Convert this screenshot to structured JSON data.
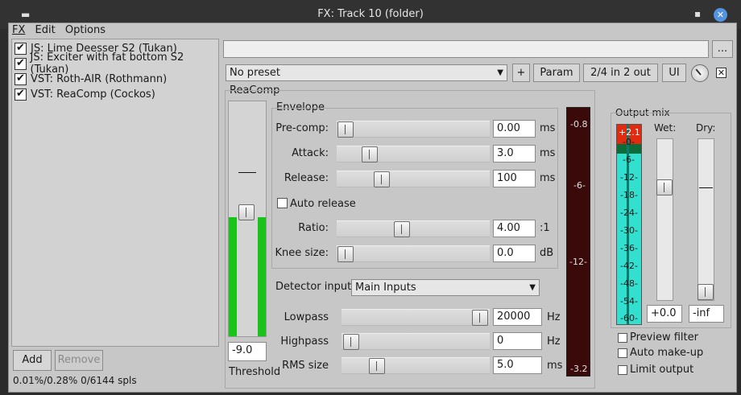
{
  "window": {
    "title": "FX: Track 10 (folder)"
  },
  "menu": {
    "fx": "FX",
    "edit": "Edit",
    "options": "Options"
  },
  "fx_chain": [
    {
      "label": "JS: Lime Deesser S2 (Tukan)",
      "enabled": true
    },
    {
      "label": "JS: Exciter with fat bottom S2 (Tukan)",
      "enabled": true
    },
    {
      "label": "VST: Roth-AIR (Rothmann)",
      "enabled": true
    },
    {
      "label": "VST: ReaComp (Cockos)",
      "enabled": true
    }
  ],
  "buttons": {
    "add": "Add",
    "remove": "Remove",
    "browse": "...",
    "plus": "+",
    "param": "Param",
    "io": "2/4 in 2 out",
    "ui": "UI"
  },
  "status": "0.01%/0.28% 0/6144 spls",
  "preset": {
    "value": "No preset"
  },
  "plugin": {
    "name": "ReaComp",
    "threshold_label": "Threshold",
    "threshold_value": "-9.0",
    "envelope": {
      "label": "Envelope",
      "precomp": {
        "label": "Pre-comp:",
        "value": "0.00",
        "unit": "ms"
      },
      "attack": {
        "label": "Attack:",
        "value": "3.0",
        "unit": "ms"
      },
      "release": {
        "label": "Release:",
        "value": "100",
        "unit": "ms"
      },
      "auto_release": {
        "label": "Auto release",
        "checked": false
      },
      "ratio": {
        "label": "Ratio:",
        "value": "4.00",
        "unit": ":1"
      },
      "knee": {
        "label": "Knee size:",
        "value": "0.0",
        "unit": "dB"
      }
    },
    "detector": {
      "label": "Detector input:",
      "value": "Main Inputs"
    },
    "lowpass": {
      "label": "Lowpass",
      "value": "20000",
      "unit": "Hz"
    },
    "highpass": {
      "label": "Highpass",
      "value": "0",
      "unit": "Hz"
    },
    "rms": {
      "label": "RMS size",
      "value": "5.0",
      "unit": "ms"
    },
    "gr_meter": {
      "labels": [
        "-0.8",
        "-6-",
        "-12-",
        "-3.2"
      ]
    },
    "output_mix": {
      "label": "Output mix",
      "wet_label": "Wet:",
      "dry_label": "Dry:",
      "wet_value": "+0.0",
      "dry_value": "-inf",
      "peak": "+2.1",
      "scale": [
        "-0-",
        "-6-",
        "-12-",
        "-18-",
        "-24-",
        "-30-",
        "-36-",
        "-42-",
        "-48-",
        "-54-",
        "-60-"
      ]
    },
    "options": {
      "preview_filter": {
        "label": "Preview filter",
        "checked": false
      },
      "auto_makeup": {
        "label": "Auto make-up",
        "checked": false
      },
      "limit_output": {
        "label": "Limit output",
        "checked": false
      }
    }
  },
  "colors": {
    "meter_green": "#19c319",
    "meter_cyan": "#33e0d0",
    "meter_red": "#e02b10",
    "gr_meter_bg": "#3a0a0a"
  }
}
